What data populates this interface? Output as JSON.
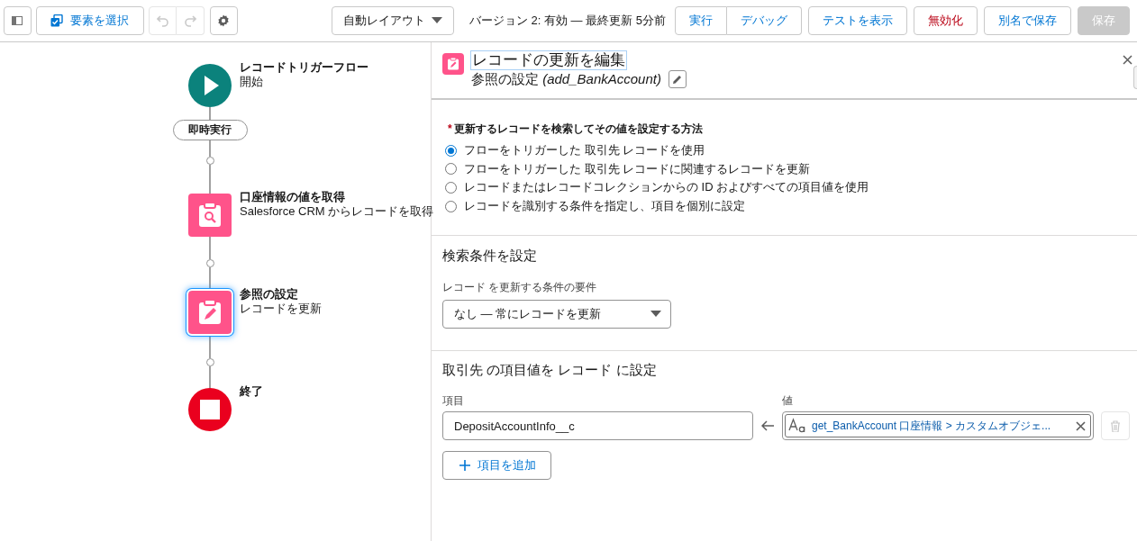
{
  "toolbar": {
    "select_button": {
      "label": "要素を選択"
    },
    "undo": {
      "disabled": true
    },
    "redo": {
      "disabled": true
    },
    "layout_dropdown": {
      "value": "自動レイアウト"
    },
    "version_status": "バージョン 2: 有効 — 最終更新 5分前",
    "button_groups": [
      [
        {
          "label": "実行",
          "kind": "neutral",
          "disabled": false
        },
        {
          "label": "デバッグ",
          "kind": "neutral",
          "disabled": false
        }
      ],
      [
        {
          "label": "テストを表示",
          "kind": "neutral",
          "disabled": false
        }
      ],
      [
        {
          "label": "無効化",
          "kind": "destructive",
          "disabled": false
        }
      ],
      [
        {
          "label": "別名で保存",
          "kind": "neutral",
          "disabled": false
        }
      ],
      [
        {
          "label": "保存",
          "kind": "brand",
          "disabled": true
        }
      ]
    ]
  },
  "canvas": {
    "elements": [
      {
        "kind": "start",
        "title": "レコードトリガーフロー",
        "subtitle": "開始",
        "selected": false
      },
      {
        "kind": "path",
        "label": "即時実行"
      },
      {
        "kind": "get_records",
        "title": "口座情報の値を取得",
        "subtitle": "Salesforce CRM からレコードを取得",
        "selected": false
      },
      {
        "kind": "update_records",
        "title": "参照の設定",
        "subtitle": "レコードを更新",
        "selected": true
      },
      {
        "kind": "end",
        "title": "終了",
        "selected": false
      }
    ]
  },
  "panel": {
    "title": "レコードの更新を編集",
    "subtitle": "参照の設定 *(add_BankAccount)*",
    "method": {
      "required_mark": "*",
      "label": "更新するレコードを検索してその値を設定する方法",
      "options": [
        {
          "label": "フローをトリガーした 取引先 レコードを使用",
          "selected": true
        },
        {
          "label": "フローをトリガーした 取引先 レコードに関連するレコードを更新",
          "selected": false
        },
        {
          "label": "レコードまたはレコードコレクションからの ID およびすべての項目値を使用",
          "selected": false
        },
        {
          "label": "レコードを識別する条件を指定し、項目を個別に設定",
          "selected": false
        }
      ]
    },
    "filter": {
      "heading": "検索条件を設定",
      "condition_label": "レコード を更新する条件の要件",
      "condition_value": "なし — 常にレコードを更新"
    },
    "assignments": {
      "heading": "取引先 の項目値を レコード に設定",
      "field_label": "項目",
      "value_label": "値",
      "rows": [
        {
          "field": "DepositAccountInfo__c",
          "value": "get_BankAccount 口座情報 > カスタムオブジェ...",
          "delete_disabled": true
        }
      ],
      "add_button": "項目を追加"
    }
  }
}
